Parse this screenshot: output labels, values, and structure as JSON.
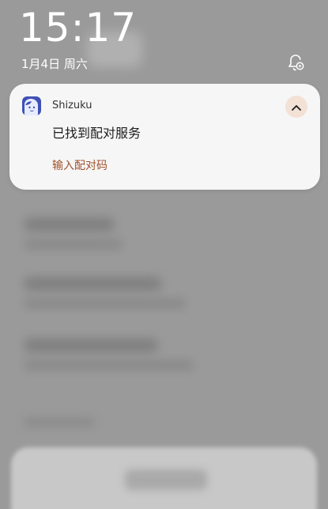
{
  "status": {
    "time": "15:17",
    "date": "1月4日 周六"
  },
  "notification": {
    "app_name": "Shizuku",
    "title": "已找到配对服务",
    "action_label": "输入配对码"
  },
  "icons": {
    "app": "shizuku-app-icon",
    "expand": "chevron-up-icon",
    "settings": "notification-settings-icon"
  },
  "colors": {
    "action_text": "#a0522d",
    "expand_bg": "#f3e1d6",
    "card_bg": "#f6f6f6"
  }
}
